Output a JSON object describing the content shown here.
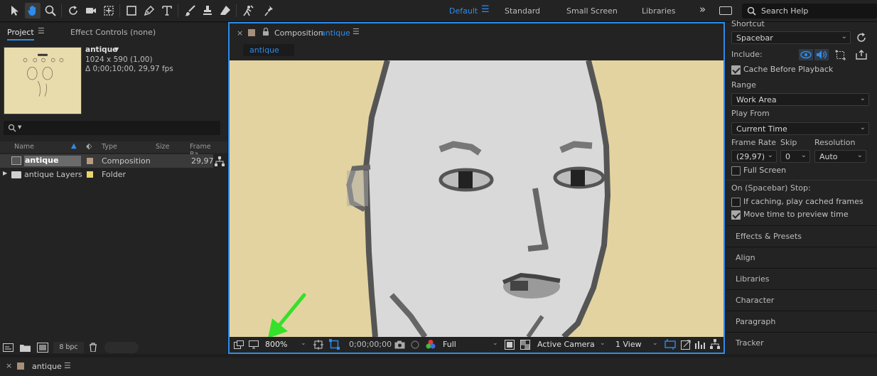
{
  "toolbar": {
    "tools": [
      "selection-tool",
      "hand-tool",
      "zoom-tool",
      "rotate-tool",
      "camera-tool",
      "pan-behind-tool",
      "rectangle-tool",
      "pen-tool",
      "type-tool",
      "brush-tool",
      "clone-stamp-tool",
      "eraser-tool",
      "roto-brush-tool",
      "puppet-pin-tool"
    ],
    "workspaces": [
      "Default",
      "Standard",
      "Small Screen",
      "Libraries"
    ],
    "active_workspace": "Default",
    "overflow": "»",
    "search_label": "Search Help"
  },
  "project_panel": {
    "tab_project": "Project",
    "tab_effect_controls": "Effect Controls (none)",
    "selected_name": "antique",
    "dimensions": "1024 x 590 (1,00)",
    "duration": "Δ 0;00;10;00, 29,97 fps",
    "search_placeholder": "",
    "columns": {
      "name": "Name",
      "type": "Type",
      "size": "Size",
      "frame_rate": "Frame Ra..."
    },
    "rows": [
      {
        "name": "antique",
        "type": "Composition",
        "size": "",
        "frame_rate": "29,97",
        "swatch": "#b89b80"
      },
      {
        "name": "antique Layers",
        "type": "Folder",
        "size": "",
        "frame_rate": "",
        "swatch": "#e9d66b"
      }
    ],
    "bpc": "8 bpc"
  },
  "composition_panel": {
    "title_prefix": "Composition",
    "title_name": "antique",
    "flow_tab": "antique",
    "zoom": "800%",
    "timecode": "0;00;00;00",
    "resolution": "Full",
    "camera": "Active Camera",
    "views": "1 View"
  },
  "preview_panel": {
    "shortcut_label": "Shortcut",
    "shortcut_value": "Spacebar",
    "include_label": "Include:",
    "cache_label": "Cache Before Playback",
    "cache_checked": true,
    "range_label": "Range",
    "range_value": "Work Area",
    "play_from_label": "Play From",
    "play_from_value": "Current Time",
    "frame_rate_label": "Frame Rate",
    "skip_label": "Skip",
    "resolution_label": "Resolution",
    "frame_rate_value": "(29,97)",
    "skip_value": "0",
    "resolution_value": "Auto",
    "full_screen_label": "Full Screen",
    "full_screen_checked": false,
    "stop_label": "On (Spacebar) Stop:",
    "if_caching_label": "If caching, play cached frames",
    "if_caching_checked": false,
    "move_time_label": "Move time to preview time",
    "move_time_checked": true,
    "collapsed_panels": [
      "Effects & Presets",
      "Align",
      "Libraries",
      "Character",
      "Paragraph",
      "Tracker"
    ]
  },
  "timeline": {
    "tab_name": "antique"
  },
  "colors": {
    "accent": "#2d8ceb",
    "viewer_bg": "#e3d3a0",
    "annotation_arrow": "#35e12a"
  }
}
